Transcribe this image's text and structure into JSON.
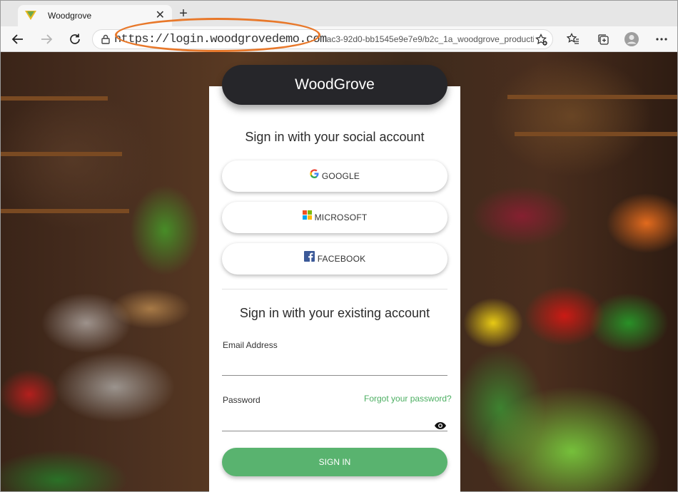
{
  "browser": {
    "tab_title": "Woodgrove",
    "tab_close": "✕",
    "new_tab": "+",
    "url_main": "https://login.woodgrovedemo.com",
    "url_rest": "ac3-92d0-bb1545e9e7e9/b2c_1a_woodgrove_producti...",
    "icons": [
      "back-icon",
      "forward-icon",
      "refresh-icon",
      "lock-icon",
      "favorites-add-icon",
      "favorites-icon",
      "collections-icon",
      "profile-icon",
      "more-icon"
    ]
  },
  "login": {
    "brand": "WoodGrove",
    "social_heading": "Sign in with your social account",
    "social_buttons": [
      "GOOGLE",
      "MICROSOFT",
      "FACEBOOK"
    ],
    "existing_heading": "Sign in with your existing account",
    "email_label": "Email Address",
    "password_label": "Password",
    "forgot_password": "Forgot your password?",
    "sign_in": "SIGN IN"
  },
  "colors": {
    "brand_pill": "#26262a",
    "accent_green": "#59b36f",
    "link_green": "#4caf62",
    "highlight_oval": "#e8782a"
  }
}
